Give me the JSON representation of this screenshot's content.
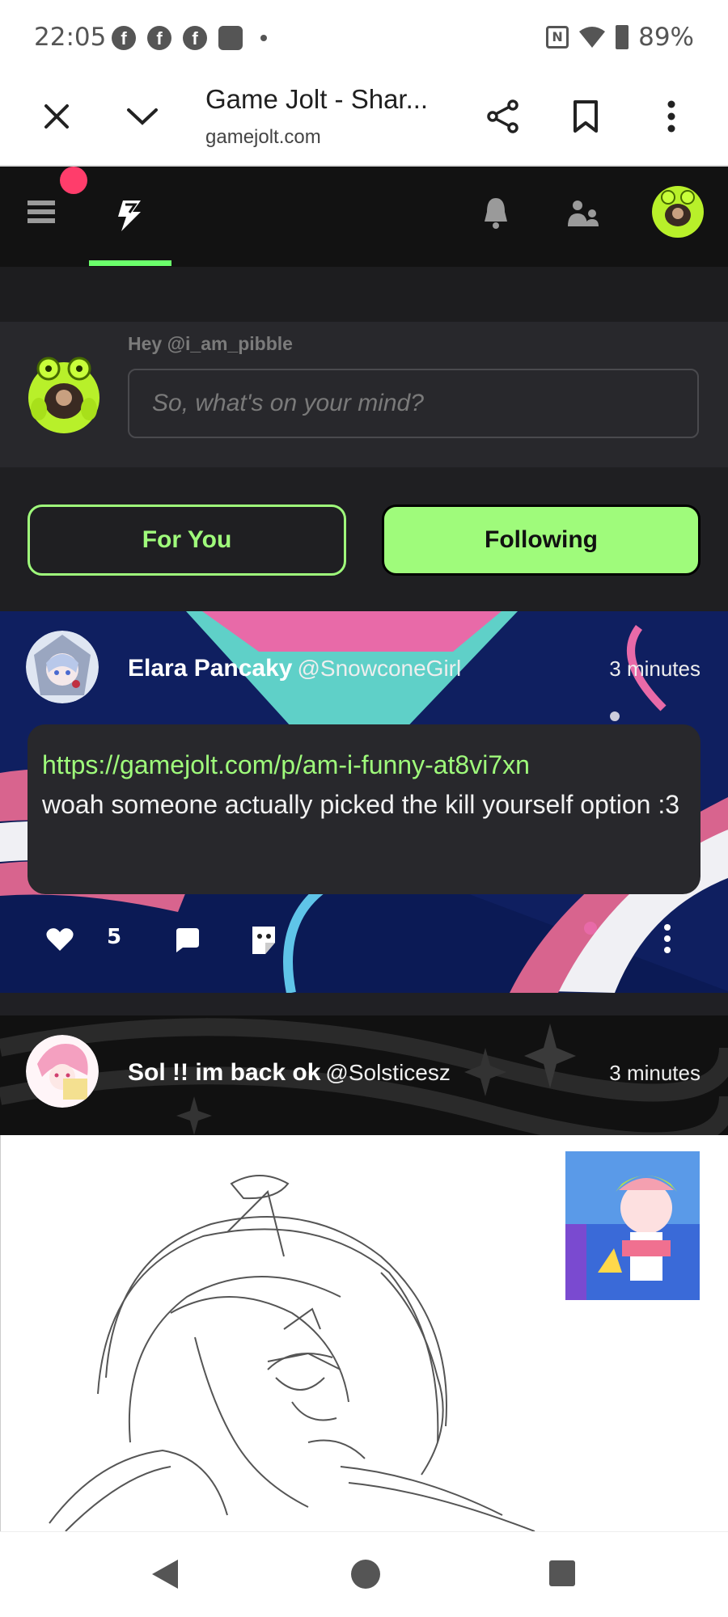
{
  "status_bar": {
    "time": "22:05",
    "battery": "89%"
  },
  "browser": {
    "title": "Game Jolt - Shar...",
    "url": "gamejolt.com"
  },
  "composer": {
    "greeting": "Hey @i_am_pibble",
    "placeholder": "So, what's on your mind?"
  },
  "tabs": {
    "for_you": "For You",
    "following": "Following",
    "active": "Following"
  },
  "posts": [
    {
      "author": "Elara Pancaky",
      "handle": "@SnowconeGirl",
      "time": "3 minutes",
      "link": "https://gamejolt.com/p/am-i-funny-at8vi7xn",
      "text": "woah someone actually picked the kill yourself option :3",
      "likes": "5"
    },
    {
      "author": "Sol !! im back ok",
      "handle": "@Solsticesz",
      "time": "3 minutes"
    }
  ],
  "colors": {
    "accent": "#9ffb7b",
    "notification": "#ff3d6b",
    "nav_bg": "#121212",
    "surface": "#28282c"
  }
}
